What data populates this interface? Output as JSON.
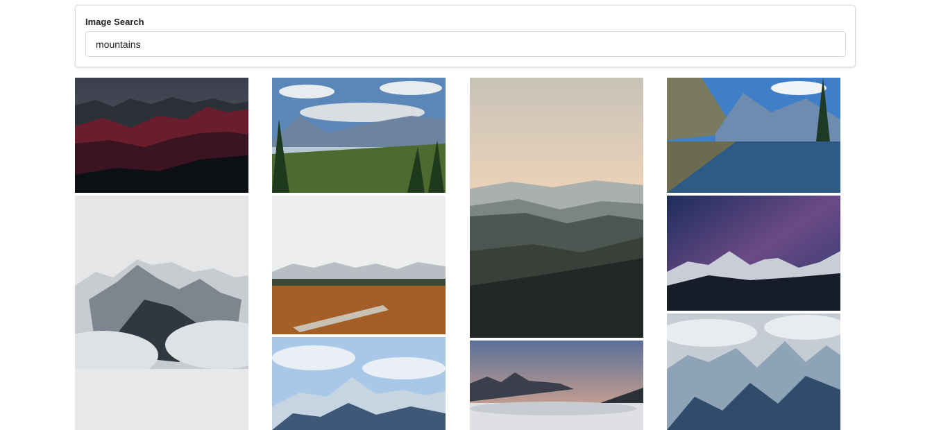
{
  "search": {
    "label": "Image Search",
    "value": "mountains"
  },
  "results": [
    {
      "name": "photo-dark-red-mountains"
    },
    {
      "name": "photo-valley-forest-lake"
    },
    {
      "name": "photo-misty-hills-sunset"
    },
    {
      "name": "photo-lake-reflection-peaks"
    },
    {
      "name": "photo-snow-peak-clouds"
    },
    {
      "name": "photo-boardwalk-plains"
    },
    {
      "name": "photo-milky-way-peaks"
    },
    {
      "name": "photo-snowy-range-blue-sky"
    },
    {
      "name": "photo-sunset-above-clouds"
    },
    {
      "name": "photo-alpine-jagged-peaks"
    }
  ],
  "colors": {
    "accent_border": "#dcdcdc",
    "text": "#222222"
  }
}
